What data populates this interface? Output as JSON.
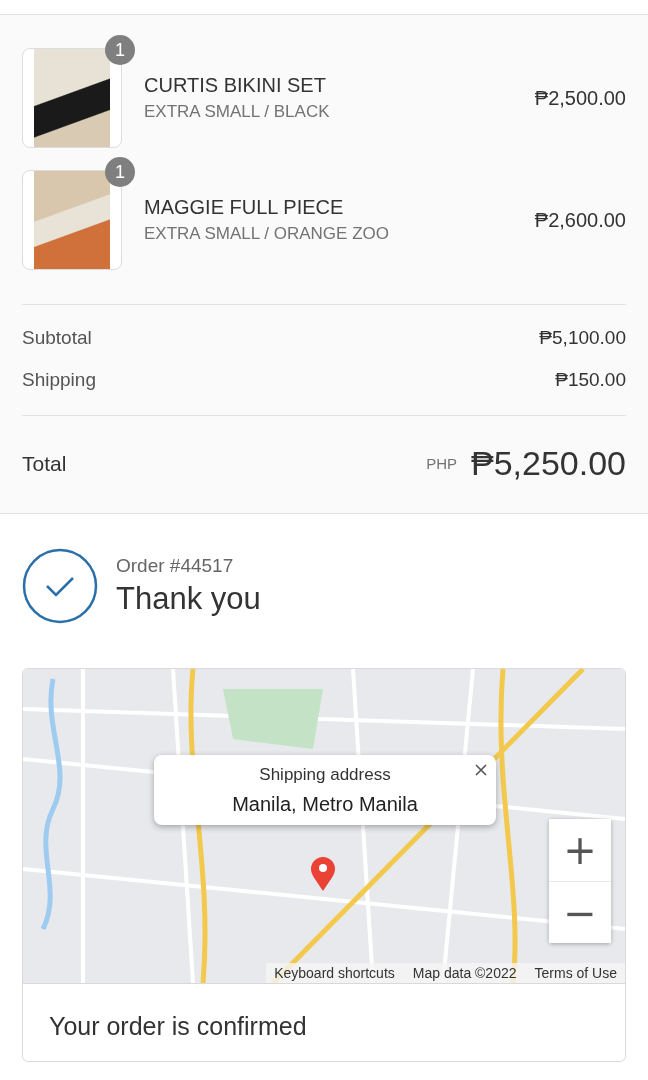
{
  "items": [
    {
      "name": "CURTIS BIKINI SET",
      "variant": "EXTRA SMALL / BLACK",
      "price": "₱2,500.00",
      "quantity": "1"
    },
    {
      "name": "MAGGIE FULL PIECE",
      "variant": "EXTRA SMALL / ORANGE ZOO",
      "price": "₱2,600.00",
      "quantity": "1"
    }
  ],
  "costs": [
    {
      "label": "Subtotal",
      "value": "₱5,100.00"
    },
    {
      "label": "Shipping",
      "value": "₱150.00"
    }
  ],
  "total": {
    "label": "Total",
    "currency": "PHP",
    "value": "₱5,250.00"
  },
  "order": {
    "number": "Order #44517",
    "heading": "Thank you"
  },
  "map": {
    "popup_title": "Shipping address",
    "popup_address": "Manila, Metro Manila",
    "zoom_in": "+",
    "zoom_out": "−",
    "attribution": [
      "Keyboard shortcuts",
      "Map data ©2022",
      "Terms of Use"
    ]
  },
  "confirmation": {
    "heading": "Your order is confirmed"
  }
}
